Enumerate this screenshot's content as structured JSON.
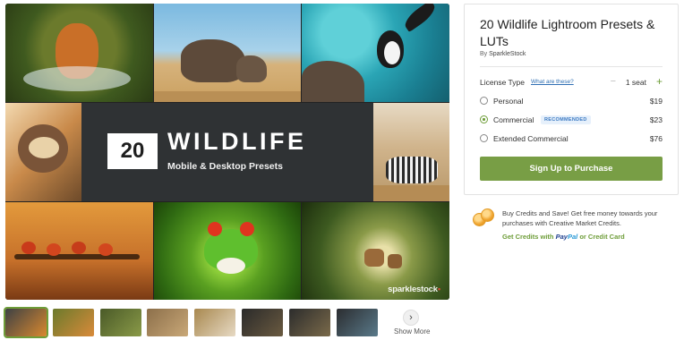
{
  "preview": {
    "number": "20",
    "title": "WILDLIFE",
    "subtitle": "Mobile & Desktop Presets",
    "watermark": "sparklestock"
  },
  "thumbnails": {
    "show_more_label": "Show More",
    "items": [
      {
        "name": "thumb-cover",
        "colors": [
          "#3d4144",
          "#d9882f"
        ]
      },
      {
        "name": "thumb-tiger",
        "colors": [
          "#6b7a2c",
          "#d98a3a"
        ]
      },
      {
        "name": "thumb-forest",
        "colors": [
          "#4a5a28",
          "#8a9a48"
        ]
      },
      {
        "name": "thumb-elephants",
        "colors": [
          "#8c6f4a",
          "#c9a878"
        ]
      },
      {
        "name": "thumb-zebras",
        "colors": [
          "#a8884f",
          "#e7dac4"
        ]
      },
      {
        "name": "thumb-dark-1",
        "colors": [
          "#2a2a2a",
          "#6a5a40"
        ]
      },
      {
        "name": "thumb-dark-2",
        "colors": [
          "#2c2c2c",
          "#7a6a4a"
        ]
      },
      {
        "name": "thumb-dark-3",
        "colors": [
          "#2b2d30",
          "#5a7a8a"
        ]
      }
    ]
  },
  "product": {
    "title": "20 Wildlife Lightroom Presets & LUTs",
    "by_prefix": "By",
    "author": "SparkleStock"
  },
  "license": {
    "label": "License Type",
    "help_link": "What are these?",
    "seat_minus": "−",
    "seat_count": "1 seat",
    "seat_plus": "+",
    "options": [
      {
        "label": "Personal",
        "price": "$19",
        "badge": "",
        "selected": false
      },
      {
        "label": "Commercial",
        "price": "$23",
        "badge": "RECOMMENDED",
        "selected": true
      },
      {
        "label": "Extended Commercial",
        "price": "$76",
        "badge": "",
        "selected": false
      }
    ]
  },
  "purchase_button": "Sign Up to Purchase",
  "credits": {
    "text": "Buy Credits and Save! Get free money towards your purchases with Creative Market Credits.",
    "link_prefix": "Get Credits with",
    "paypal_1": "Pay",
    "paypal_2": "Pal",
    "link_suffix": "or Credit Card"
  },
  "colors": {
    "accent_green": "#789e45",
    "badge_blue": "#3b79c2",
    "banner_bg": "#2f3234"
  }
}
